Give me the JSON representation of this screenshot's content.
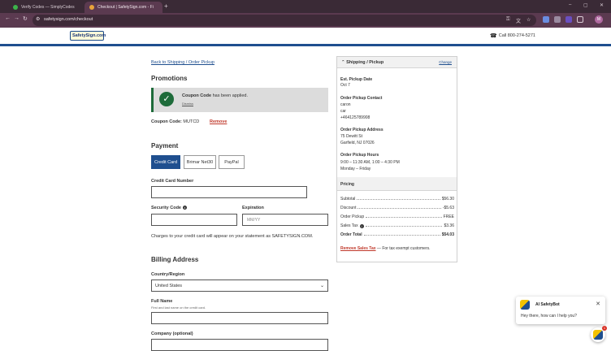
{
  "browser": {
    "tabs": [
      {
        "label": "Verify Codes — SimplyCodes",
        "favicon_color": "#3cb34a"
      },
      {
        "label": "Checkout | SafetySign.com - Fi",
        "favicon_color": "#e8a33a"
      }
    ],
    "new_tab": "+",
    "url": "safetysign.com/checkout",
    "profile_initial": "M",
    "win_min": "–",
    "win_max": "▢",
    "win_close": "✕"
  },
  "site": {
    "logo": "SafetySign.com",
    "phone": "Call 800-274-5271"
  },
  "checkout": {
    "back_link": "Back to Shipping / Order Pickup",
    "promotions": {
      "heading": "Promotions",
      "notice_bold": "Coupon Code",
      "notice_rest": " has been applied.",
      "dismiss": "Dismiss",
      "coupon_label": "Coupon Code:",
      "coupon_value": " MUTCD",
      "remove": "Remove"
    },
    "payment": {
      "heading": "Payment",
      "methods": [
        "Credit Card",
        "Brimar Net30",
        "PayPal"
      ],
      "card_number_label": "Credit Card Number",
      "security_code_label": "Security Code",
      "expiration_label": "Expiration",
      "expiration_placeholder": "MM/YY",
      "statement_note": "Charges to your credit card will appear on your statement as SAFETYSIGN.COM."
    },
    "billing": {
      "heading": "Billing Address",
      "country_label": "Country/Region",
      "country_value": "United States",
      "full_name_label": "Full Name",
      "full_name_sub": "First and last name on the credit card.",
      "company_label": "Company (optional)"
    }
  },
  "sidebar": {
    "title": "Shipping / Pickup",
    "change": "Change",
    "pickup_date_label": "Est. Pickup Date",
    "pickup_date": "Oct 7",
    "contact_label": "Order Pickup Contact",
    "contact_lines": [
      "caron",
      "car",
      "+464125789908"
    ],
    "address_label": "Order Pickup Address",
    "address_lines": [
      "75 Dewitt St",
      "Garfield, NJ 07026"
    ],
    "hours_label": "Order Pickup Hours",
    "hours_lines": [
      "9:00 – 11:30 AM, 1:00 – 4:30 PM",
      "Monday – Friday"
    ],
    "pricing_title": "Pricing",
    "pricing": [
      {
        "label": "Subtotal",
        "value": "$56.30"
      },
      {
        "label": "Discount",
        "value": "-$5.63"
      },
      {
        "label": "Order Pickup",
        "value": "FREE"
      },
      {
        "label": "Sales Tax",
        "value": "$3.36"
      },
      {
        "label": "Order Total",
        "value": "$54.03"
      }
    ],
    "tax_link": "Remove Sales Tax",
    "tax_note": " — For tax exempt customers."
  },
  "chat": {
    "name": "AI SafetyBot",
    "greeting": "Hey there, how can I help you?",
    "badge": "1"
  }
}
